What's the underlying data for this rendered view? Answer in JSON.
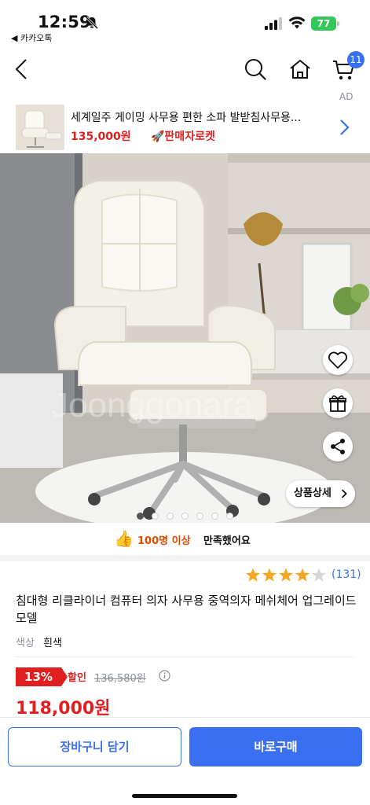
{
  "status": {
    "time": "12:59",
    "back_app": "◀ 카카오톡",
    "battery": "77"
  },
  "nav": {
    "cart_count": "11"
  },
  "ad": {
    "label": "AD",
    "title": "세계일주 게이밍 사무용 편한 소파 발받침사무용...",
    "price": "135,000원",
    "tag": "🚀판매자로켓"
  },
  "gallery": {
    "detail_button": "상품상세",
    "image_count": 7,
    "active_index": 0,
    "watermark": "Joonggonara"
  },
  "satisfaction": {
    "icon": "👍",
    "count": "100명 이상",
    "text": "만족했어요"
  },
  "rating": {
    "stars": 4,
    "count": "(131)"
  },
  "product": {
    "title": "침대형 리클라이너 컴퓨터 의자 사무용 중역의자 메쉬체어 업그레이드 모델",
    "option_label": "색상",
    "option_value": "흰색",
    "discount": "13%",
    "sale_label": "할인",
    "original_price": "136,580원",
    "price": "118,000원"
  },
  "actions": {
    "cart": "장바구니 담기",
    "buy": "바로구매"
  },
  "colors": {
    "accent": "#3a6ff0",
    "sale": "#e02020",
    "star": "#f5a623"
  }
}
